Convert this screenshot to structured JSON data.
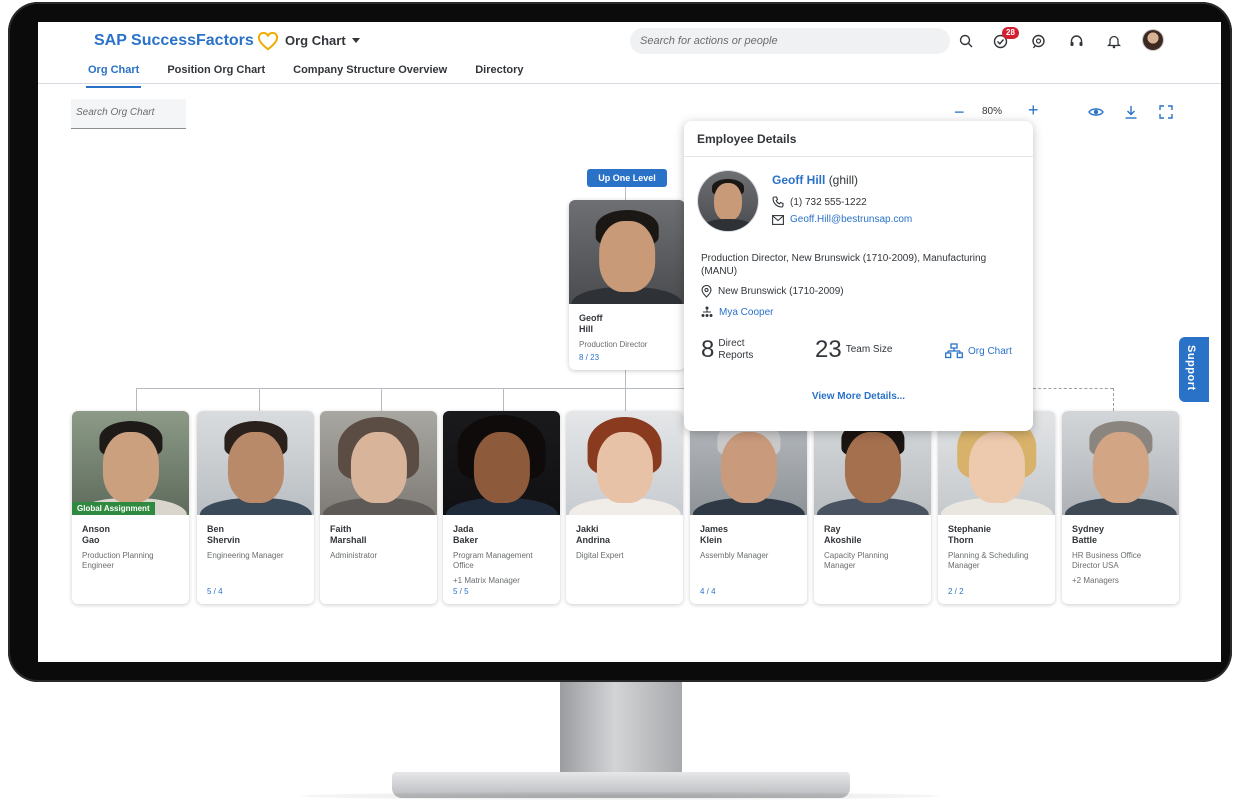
{
  "header": {
    "brand": "SAP SuccessFactors",
    "app_menu": "Org Chart",
    "search_placeholder": "Search for actions or people",
    "notification_count": "28",
    "tabs": [
      {
        "label": "Org Chart",
        "active": true
      },
      {
        "label": "Position Org Chart",
        "active": false
      },
      {
        "label": "Company Structure Overview",
        "active": false
      },
      {
        "label": "Directory",
        "active": false
      }
    ],
    "icons": [
      "search-icon",
      "tasks-icon",
      "feedback-icon",
      "headset-icon",
      "bell-icon",
      "user-avatar"
    ]
  },
  "toolbar": {
    "search_placeholder": "Search Org Chart",
    "zoom_minus": "−",
    "zoom_level": "80%",
    "zoom_plus": "+",
    "icons": [
      "eye-icon",
      "download-icon",
      "fullscreen-icon"
    ]
  },
  "manager": {
    "up_level_label": "Up One Level",
    "first_name": "Geoff",
    "last_name": "Hill",
    "title": "Production Director",
    "count": "8 / 23"
  },
  "reports": [
    {
      "first_name": "Anson",
      "last_name": "Gao",
      "title": "Production Planning Engineer",
      "extra": "",
      "count": "",
      "badge": "Global Assignment"
    },
    {
      "first_name": "Ben",
      "last_name": "Shervin",
      "title": "Engineering Manager",
      "extra": "",
      "count": "5 / 4",
      "badge": ""
    },
    {
      "first_name": "Faith",
      "last_name": "Marshall",
      "title": "Administrator",
      "extra": "",
      "count": "",
      "badge": ""
    },
    {
      "first_name": "Jada",
      "last_name": "Baker",
      "title": "Program Management Office",
      "extra": "+1 Matrix Manager",
      "count": "5 / 5",
      "badge": ""
    },
    {
      "first_name": "Jakki",
      "last_name": "Andrina",
      "title": "Digital Expert",
      "extra": "",
      "count": "",
      "badge": ""
    },
    {
      "first_name": "James",
      "last_name": "Klein",
      "title": "Assembly Manager",
      "extra": "",
      "count": "4 / 4",
      "badge": ""
    },
    {
      "first_name": "Ray",
      "last_name": "Akoshile",
      "title": "Capacity Planning Manager",
      "extra": "",
      "count": "",
      "badge": ""
    },
    {
      "first_name": "Stephanie",
      "last_name": "Thorn",
      "title": "Planning & Scheduling Manager",
      "extra": "",
      "count": "2 / 2",
      "badge": ""
    },
    {
      "first_name": "Sydney",
      "last_name": "Battle",
      "title": "HR Business Office Director USA",
      "extra": "+2 Managers",
      "count": "",
      "badge": ""
    }
  ],
  "details": {
    "heading": "Employee Details",
    "name": "Geoff Hill",
    "user_id": "(ghill)",
    "phone": "(1) 732 555-1222",
    "email": "Geoff.Hill@bestrunsap.com",
    "position": "Production Director, New Brunswick (1710-2009), Manufacturing (MANU)",
    "location": "New Brunswick (1710-2009)",
    "manager": "Mya Cooper",
    "direct_reports_count": "8",
    "direct_reports_label_1": "Direct",
    "direct_reports_label_2": "Reports",
    "team_size_count": "23",
    "team_size_label": "Team Size",
    "org_chart_link": "Org Chart",
    "view_more": "View More Details..."
  },
  "support_label": "Support",
  "colors": {
    "accent": "#2a72c8",
    "badge_red": "#d32030",
    "global_assignment": "#2e8a3e",
    "brand_heart": "#f0ab00"
  }
}
